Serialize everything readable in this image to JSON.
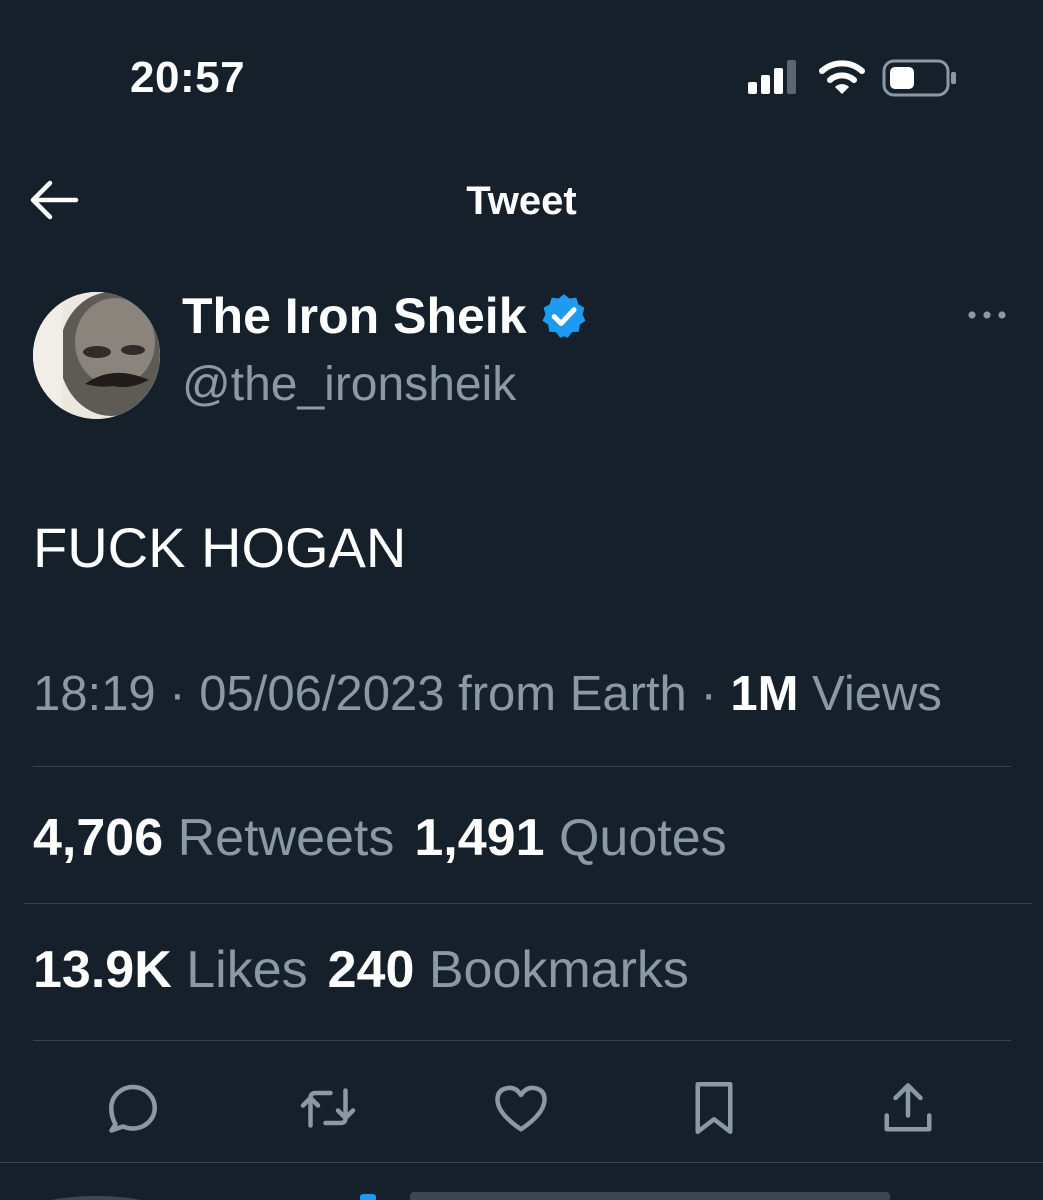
{
  "status_bar": {
    "time": "20:57",
    "icons": [
      "cellular-signal-icon",
      "wifi-icon",
      "battery-icon"
    ]
  },
  "header": {
    "back_icon": "back-arrow-icon",
    "title": "Tweet"
  },
  "author": {
    "name": "The Iron Sheik",
    "verified_icon": "verified-badge-icon",
    "handle": "@the_ironsheik",
    "more_icon": "more-options-icon"
  },
  "tweet": {
    "text": "FUCK HOGAN",
    "time": "18:19",
    "date": "05/06/2023",
    "source": "from Earth",
    "views_count": "1M",
    "views_label": "Views",
    "separator": "·"
  },
  "stats": {
    "retweets_count": "4,706",
    "retweets_label": "Retweets",
    "quotes_count": "1,491",
    "quotes_label": "Quotes",
    "likes_count": "13.9K",
    "likes_label": "Likes",
    "bookmarks_count": "240",
    "bookmarks_label": "Bookmarks"
  },
  "actions": [
    "reply-icon",
    "retweet-icon",
    "like-icon",
    "bookmark-icon",
    "share-icon"
  ],
  "colors": {
    "background": "#15202b",
    "text_primary": "#ffffff",
    "text_secondary": "#8b98a5",
    "divider": "#38444d",
    "verified": "#1d9bf0"
  }
}
